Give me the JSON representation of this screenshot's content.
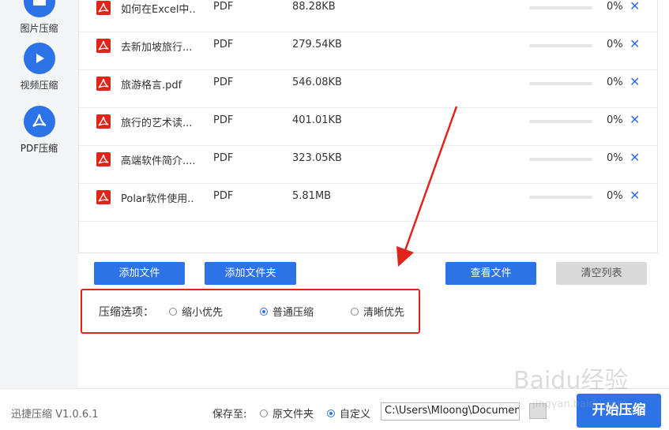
{
  "sidebar": {
    "items": [
      {
        "label": "图片压缩",
        "icon": "image-compress-icon"
      },
      {
        "label": "视频压缩",
        "icon": "play-icon"
      },
      {
        "label": "PDF压缩",
        "icon": "pdf-icon"
      }
    ],
    "accent": "#2d73e8"
  },
  "files": [
    {
      "name": "如何在Excel中..",
      "type": "PDF",
      "size": "88.28KB",
      "progress": "0%"
    },
    {
      "name": "去新加坡旅行...",
      "type": "PDF",
      "size": "279.54KB",
      "progress": "0%"
    },
    {
      "name": "旅游格言.pdf",
      "type": "PDF",
      "size": "546.08KB",
      "progress": "0%"
    },
    {
      "name": "旅行的艺术读...",
      "type": "PDF",
      "size": "401.01KB",
      "progress": "0%"
    },
    {
      "name": "高端软件简介....",
      "type": "PDF",
      "size": "323.05KB",
      "progress": "0%"
    },
    {
      "name": "Polar软件使用..",
      "type": "PDF",
      "size": "5.81MB",
      "progress": "0%"
    }
  ],
  "toolbar": {
    "add_file": "添加文件",
    "add_folder": "添加文件夹",
    "view_files": "查看文件",
    "clear_list": "清空列表"
  },
  "options": {
    "label": "压缩选项：",
    "items": [
      {
        "label": "缩小优先",
        "checked": false
      },
      {
        "label": "普通压缩",
        "checked": true
      },
      {
        "label": "清晰优先",
        "checked": false
      }
    ]
  },
  "footer": {
    "version": "迅捷压缩 V1.0.6.1",
    "save_to": "保存至:",
    "original_folder": "原文件夹",
    "custom": "自定义",
    "path": "C:\\Users\\Mloong\\Documents",
    "start": "开始压缩"
  },
  "watermark": {
    "brand": "Baidu经验",
    "url": "jingyan.baidu.com"
  },
  "colors": {
    "accent": "#2d73e8",
    "pdf_red": "#e2231a",
    "highlight": "#e2231a"
  }
}
